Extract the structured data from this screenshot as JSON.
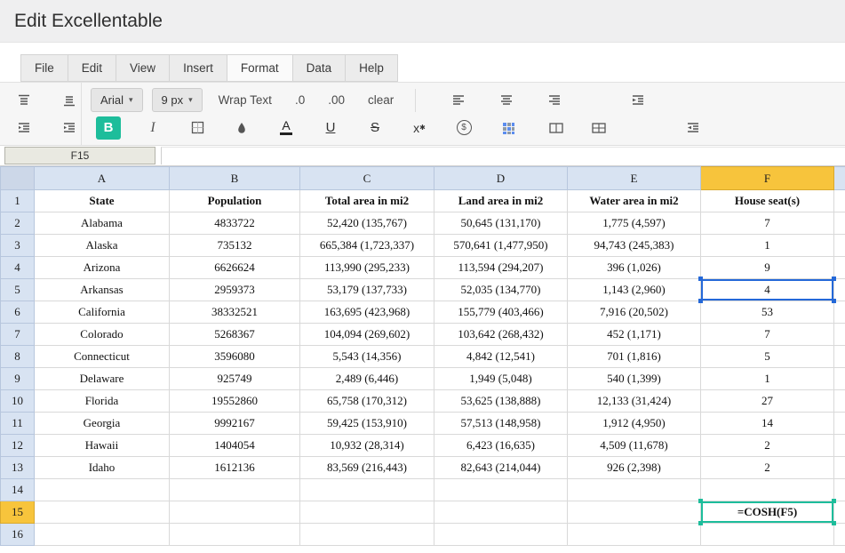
{
  "app": {
    "title": "Edit Excellentable"
  },
  "menu": {
    "items": [
      {
        "label": "File"
      },
      {
        "label": "Edit"
      },
      {
        "label": "View"
      },
      {
        "label": "Insert"
      },
      {
        "label": "Format",
        "active": true
      },
      {
        "label": "Data"
      },
      {
        "label": "Help"
      }
    ]
  },
  "toolbar": {
    "font_family_label": "Arial",
    "font_size_label": "9 px",
    "wrap_text_label": "Wrap Text",
    "decimal_decrease_label": ".0",
    "decimal_increase_label": ".00",
    "clear_label": "clear",
    "bold_label": "B",
    "italic_label": "I",
    "font_color_label": "A",
    "underline_label": "U",
    "strikethrough_label": "S",
    "superscript_label": "x",
    "currency_label": "$"
  },
  "formula_bar": {
    "cell_ref": "F15",
    "formula": ""
  },
  "grid": {
    "column_labels": [
      "A",
      "B",
      "C",
      "D",
      "E",
      "F"
    ],
    "row_count": 16,
    "selected_column": "F",
    "selected_row": 15,
    "header_row": [
      "State",
      "Population",
      "Total area in mi2",
      "Land area in mi2",
      "Water area in mi2",
      "House seat(s)"
    ],
    "data_rows": [
      [
        "Alabama",
        "4833722",
        "52,420 (135,767)",
        "50,645 (131,170)",
        "1,775 (4,597)",
        "7"
      ],
      [
        "Alaska",
        "735132",
        "665,384 (1,723,337)",
        "570,641 (1,477,950)",
        "94,743 (245,383)",
        "1"
      ],
      [
        "Arizona",
        "6626624",
        "113,990 (295,233)",
        "113,594 (294,207)",
        "396 (1,026)",
        "9"
      ],
      [
        "Arkansas",
        "2959373",
        "53,179 (137,733)",
        "52,035 (134,770)",
        "1,143 (2,960)",
        "4"
      ],
      [
        "California",
        "38332521",
        "163,695 (423,968)",
        "155,779 (403,466)",
        "7,916 (20,502)",
        "53"
      ],
      [
        "Colorado",
        "5268367",
        "104,094 (269,602)",
        "103,642 (268,432)",
        "452 (1,171)",
        "7"
      ],
      [
        "Connecticut",
        "3596080",
        "5,543 (14,356)",
        "4,842 (12,541)",
        "701 (1,816)",
        "5"
      ],
      [
        "Delaware",
        "925749",
        "2,489 (6,446)",
        "1,949 (5,048)",
        "540 (1,399)",
        "1"
      ],
      [
        "Florida",
        "19552860",
        "65,758 (170,312)",
        "53,625 (138,888)",
        "12,133 (31,424)",
        "27"
      ],
      [
        "Georgia",
        "9992167",
        "59,425 (153,910)",
        "57,513 (148,958)",
        "1,912 (4,950)",
        "14"
      ],
      [
        "Hawaii",
        "1404054",
        "10,932 (28,314)",
        "6,423 (16,635)",
        "4,509 (11,678)",
        "2"
      ],
      [
        "Idaho",
        "1612136",
        "83,569 (216,443)",
        "82,643 (214,044)",
        "926 (2,398)",
        "2"
      ]
    ],
    "referenced_cell": "F5",
    "edit_cell": {
      "ref": "F15",
      "value": "=COSH(F5)"
    }
  },
  "colors": {
    "accent_teal": "#1dbd9b",
    "selection_blue": "#2468d8",
    "header_selected_gold": "#f7c43c",
    "header_blue": "#d8e3f2"
  }
}
